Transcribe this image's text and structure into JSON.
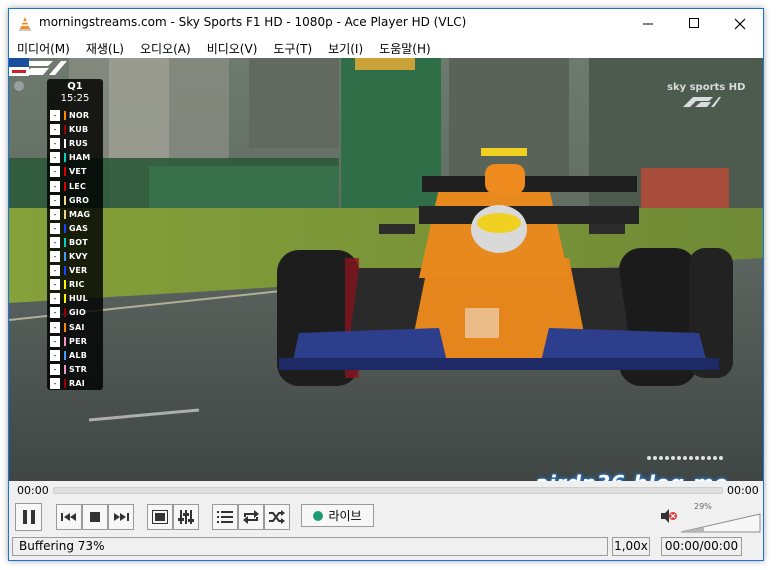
{
  "window": {
    "title": "morningstreams.com - Sky Sports F1 HD - 1080p - Ace Player HD (VLC)"
  },
  "menu": [
    "미디어(M)",
    "재생(L)",
    "오디오(A)",
    "비디오(V)",
    "도구(T)",
    "보기(I)",
    "도움말(H)"
  ],
  "overlay": {
    "session": "Q1",
    "clock": "15:25",
    "timing_tower": [
      {
        "pos": "-",
        "code": "NOR",
        "team_color": "#ff8700"
      },
      {
        "pos": "-",
        "code": "KUB",
        "team_color": "#9b0000"
      },
      {
        "pos": "-",
        "code": "RUS",
        "team_color": "#ffffff"
      },
      {
        "pos": "-",
        "code": "HAM",
        "team_color": "#00d2be"
      },
      {
        "pos": "-",
        "code": "VET",
        "team_color": "#dc0000"
      },
      {
        "pos": "-",
        "code": "LEC",
        "team_color": "#dc0000"
      },
      {
        "pos": "-",
        "code": "GRO",
        "team_color": "#f0d787"
      },
      {
        "pos": "-",
        "code": "MAG",
        "team_color": "#f0d787"
      },
      {
        "pos": "-",
        "code": "GAS",
        "team_color": "#1e41ff"
      },
      {
        "pos": "-",
        "code": "BOT",
        "team_color": "#00d2be"
      },
      {
        "pos": "-",
        "code": "KVY",
        "team_color": "#469bff"
      },
      {
        "pos": "-",
        "code": "VER",
        "team_color": "#1e41ff"
      },
      {
        "pos": "-",
        "code": "RIC",
        "team_color": "#fff500"
      },
      {
        "pos": "-",
        "code": "HUL",
        "team_color": "#fff500"
      },
      {
        "pos": "-",
        "code": "GIO",
        "team_color": "#9b0000"
      },
      {
        "pos": "-",
        "code": "SAI",
        "team_color": "#ff8700"
      },
      {
        "pos": "-",
        "code": "PER",
        "team_color": "#f596c8"
      },
      {
        "pos": "-",
        "code": "ALB",
        "team_color": "#469bff"
      },
      {
        "pos": "-",
        "code": "STR",
        "team_color": "#f596c8"
      },
      {
        "pos": "-",
        "code": "RAI",
        "team_color": "#9b0000"
      }
    ],
    "channel_logo": "sky sports HD",
    "watermark": "airdp36.blog.me"
  },
  "seek": {
    "elapsed": "00:00",
    "total": "00:00"
  },
  "controls": {
    "live_label": "라이브",
    "volume_percent": "29%"
  },
  "status": {
    "message": "Buffering 73%",
    "speed": "1,00x",
    "time": "00:00/00:00"
  }
}
